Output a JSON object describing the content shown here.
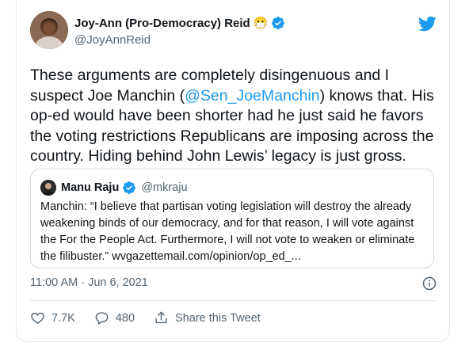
{
  "author": {
    "name": "Joy-Ann (Pro-Democracy) Reid",
    "emoji": "😷",
    "handle": "@JoyAnnReid",
    "verified": true
  },
  "tweet": {
    "text_before": "These arguments are completely disingenuous and I suspect Joe Manchin (",
    "mention": "@Sen_JoeManchin",
    "text_after": ") knows that. His op-ed would have been shorter had he just said he favors the voting restrictions Republicans are imposing across the country. Hiding behind John Lewis’ legacy is just gross."
  },
  "quoted": {
    "name": "Manu Raju",
    "handle": "@mkraju",
    "verified": true,
    "text": "Manchin: “I believe that partisan voting legislation will destroy the already weakening binds of our democracy, and for that reason, I will vote against the For the People Act. Furthermore, I will not vote to weaken or eliminate the filibuster.” wvgazettemail.com/opinion/op_ed_..."
  },
  "timestamp": "11:00 AM · Jun 6, 2021",
  "actions": {
    "likes": "7.7K",
    "replies": "480",
    "share_label": "Share this Tweet"
  },
  "colors": {
    "accent": "#1d9bf0",
    "secondary_text": "#536471",
    "border": "#e1e8ed"
  }
}
